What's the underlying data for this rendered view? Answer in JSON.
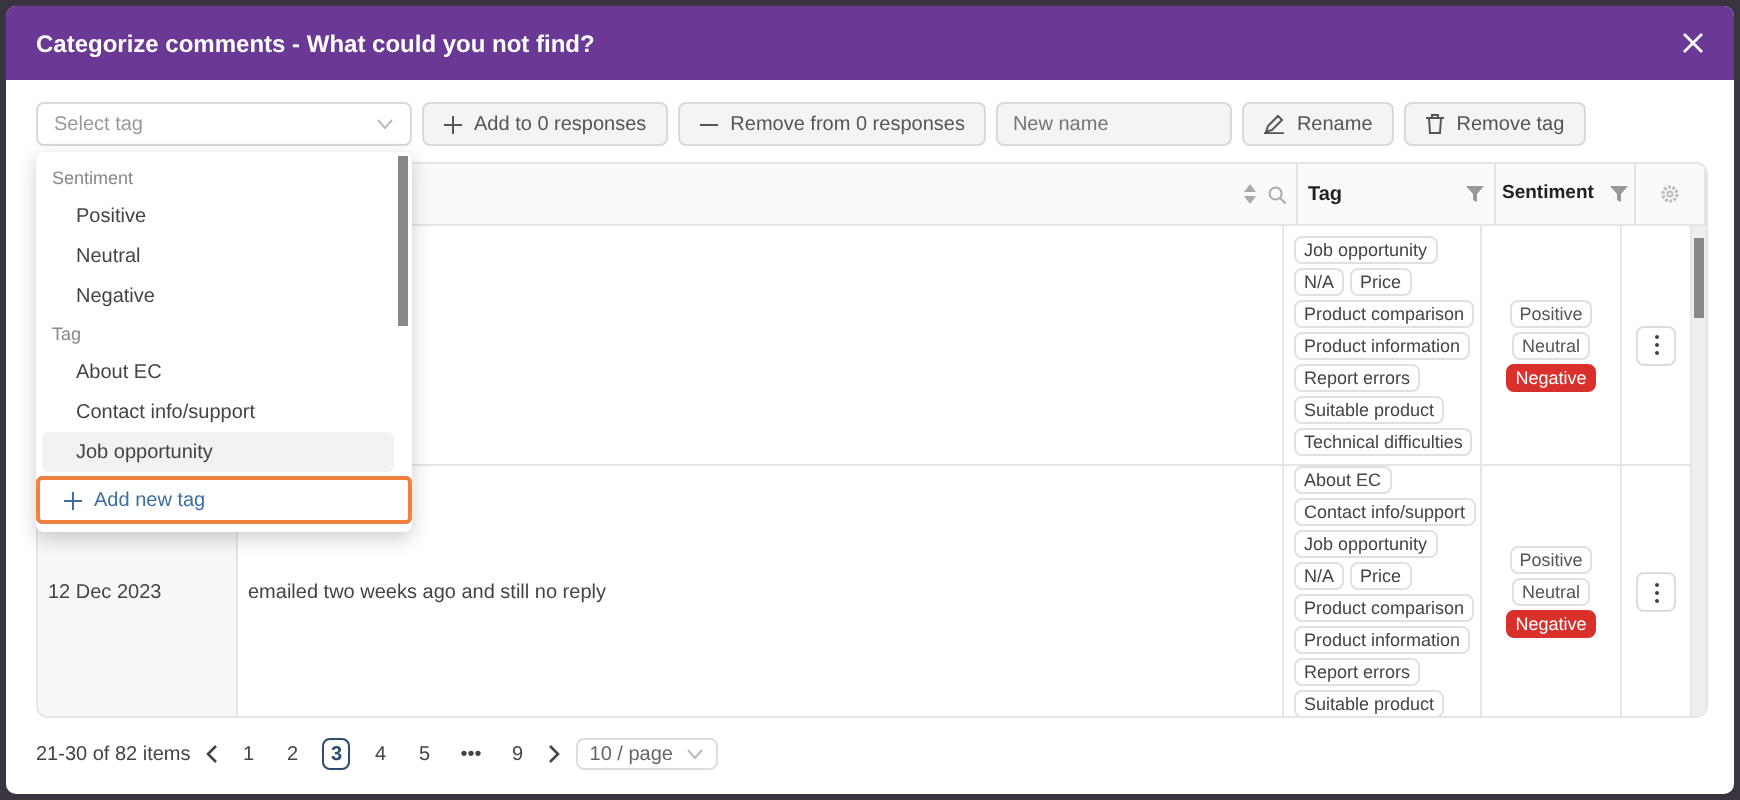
{
  "dialog": {
    "title": "Categorize comments - What could you not find?"
  },
  "toolbar": {
    "tag_select": {
      "placeholder": "Select tag"
    },
    "add_button": "Add to 0 responses",
    "remove_button": "Remove from 0 responses",
    "name_field": {
      "placeholder": "New name"
    },
    "rename_button": "Rename",
    "remove_tag_button": "Remove tag"
  },
  "table": {
    "columns": [
      {
        "label": "Tag"
      },
      {
        "label": "Sentiment"
      }
    ],
    "rows": [
      {
        "tags": [
          "Job opportunity",
          "N/A",
          "Price",
          "Product comparison",
          "Product information",
          "Report errors",
          "Suitable product",
          "Technical difficulties"
        ],
        "sentiments": [
          {
            "label": "Positive",
            "selected": false
          },
          {
            "label": "Neutral",
            "selected": false
          },
          {
            "label": "Negative",
            "selected": true
          }
        ]
      },
      {
        "date": "12 Dec 2023",
        "comment": "emailed two weeks ago and still no reply",
        "tags": [
          "About EC",
          "Contact info/support",
          "Job opportunity",
          "N/A",
          "Price",
          "Product comparison",
          "Product information",
          "Report errors",
          "Suitable product"
        ],
        "sentiments": [
          {
            "label": "Positive",
            "selected": false
          },
          {
            "label": "Neutral",
            "selected": false
          },
          {
            "label": "Negative",
            "selected": true
          }
        ]
      }
    ]
  },
  "dropdown": {
    "groups": [
      {
        "label": "Sentiment",
        "options": [
          {
            "label": "Positive",
            "hovered": false
          },
          {
            "label": "Neutral",
            "hovered": false
          },
          {
            "label": "Negative",
            "hovered": false
          }
        ]
      },
      {
        "label": "Tag",
        "options": [
          {
            "label": "About EC",
            "hovered": false
          },
          {
            "label": "Contact info/support",
            "hovered": false
          },
          {
            "label": "Job opportunity",
            "hovered": true
          }
        ]
      }
    ],
    "add_label": "Add new tag",
    "add_highlighted": true
  },
  "pagination": {
    "summary": "21-30 of 82 items",
    "pages": [
      {
        "label": "1",
        "kind": "page",
        "selected": false
      },
      {
        "label": "2",
        "kind": "page",
        "selected": false
      },
      {
        "label": "3",
        "kind": "page",
        "selected": true
      },
      {
        "label": "4",
        "kind": "page",
        "selected": false
      },
      {
        "label": "5",
        "kind": "page",
        "selected": false
      },
      {
        "label": "•••",
        "kind": "ellipsis"
      },
      {
        "label": "9",
        "kind": "page",
        "selected": false
      }
    ],
    "page_size": "10 / page"
  }
}
